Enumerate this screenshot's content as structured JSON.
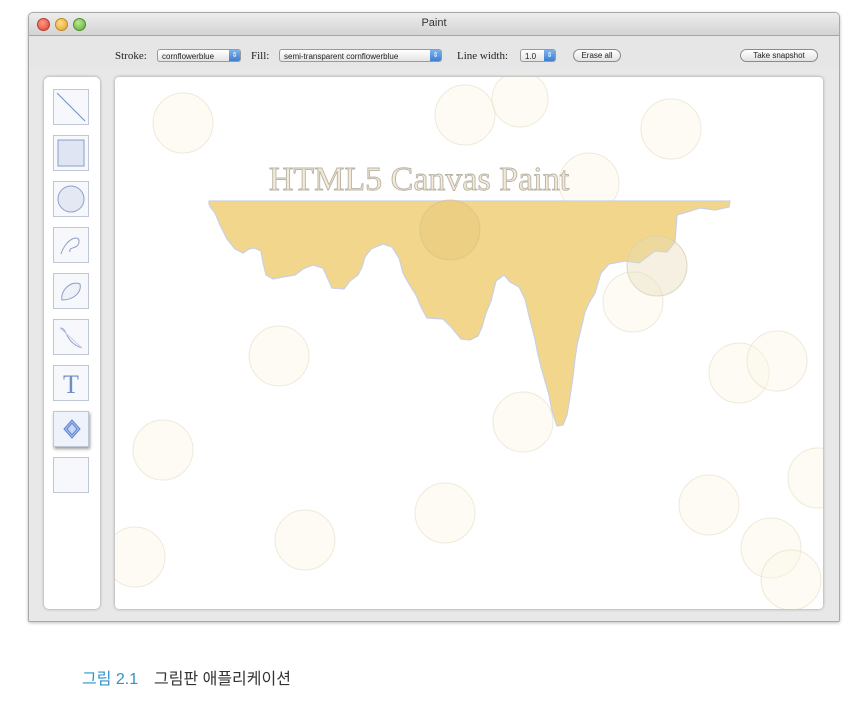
{
  "window": {
    "title": "Paint"
  },
  "controls": {
    "stroke_label": "Stroke:",
    "stroke_value": "cornflowerblue",
    "fill_label": "Fill:",
    "fill_value": "semi-transparent cornflowerblue",
    "line_width_label": "Line width:",
    "line_width_value": "1.0",
    "erase_all": "Erase all",
    "take_snapshot": "Take snapshot"
  },
  "tools": [
    {
      "icon": "line-icon"
    },
    {
      "icon": "rectangle-icon"
    },
    {
      "icon": "circle-icon"
    },
    {
      "icon": "path-icon"
    },
    {
      "icon": "closed-path-icon"
    },
    {
      "icon": "curve-icon"
    },
    {
      "icon": "text-icon",
      "glyph": "T"
    },
    {
      "icon": "slinky-icon",
      "selected": true
    },
    {
      "icon": "eraser-icon"
    }
  ],
  "canvas": {
    "title": "HTML5 Canvas Paint"
  },
  "caption": {
    "number": "그림 2.1",
    "text": "그림판 애플리케이션"
  },
  "colors": {
    "accent": "#6495ed",
    "drip_fill": "#f2d68c",
    "caption_number": "#2f93c8"
  }
}
